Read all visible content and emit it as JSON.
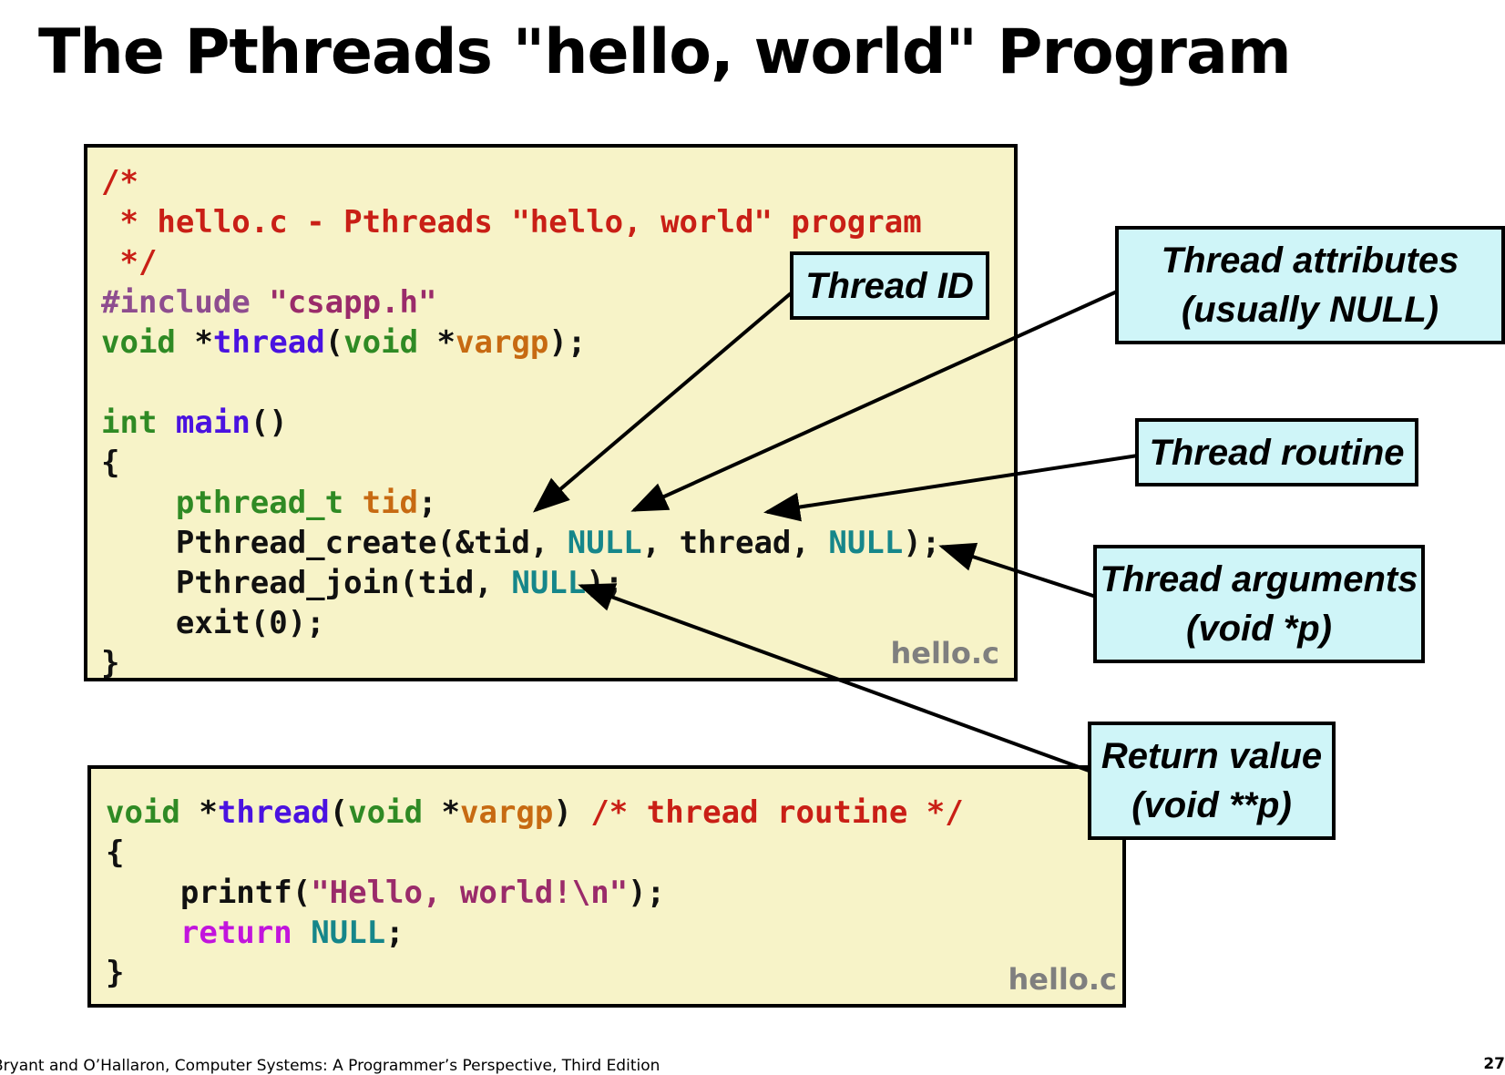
{
  "slide": {
    "title": "The Pthreads \"hello, world\" Program",
    "page_number": "27",
    "footer": "Bryant and O’Hallaron, Computer Systems: A Programmer’s Perspective, Third Edition"
  },
  "main_code": {
    "filename": "hello.c",
    "lines": [
      [
        {
          "t": "/*",
          "c": "comment"
        }
      ],
      [
        {
          "t": " * hello.c - Pthreads \"hello, world\" program",
          "c": "comment"
        }
      ],
      [
        {
          "t": " */",
          "c": "comment"
        }
      ],
      [
        {
          "t": "#include ",
          "c": "pre"
        },
        {
          "t": "\"csapp.h\"",
          "c": "str"
        }
      ],
      [
        {
          "t": "void",
          "c": "type"
        },
        {
          "t": " *",
          "c": ""
        },
        {
          "t": "thread",
          "c": "fn"
        },
        {
          "t": "(",
          "c": ""
        },
        {
          "t": "void",
          "c": "type"
        },
        {
          "t": " *",
          "c": ""
        },
        {
          "t": "vargp",
          "c": "var"
        },
        {
          "t": ");",
          "c": ""
        }
      ],
      [],
      [
        {
          "t": "int",
          "c": "type"
        },
        {
          "t": " ",
          "c": ""
        },
        {
          "t": "main",
          "c": "fn"
        },
        {
          "t": "()",
          "c": ""
        }
      ],
      [
        {
          "t": "{",
          "c": ""
        }
      ],
      [
        {
          "t": "    ",
          "c": ""
        },
        {
          "t": "pthread_t",
          "c": "type"
        },
        {
          "t": " ",
          "c": ""
        },
        {
          "t": "tid",
          "c": "var"
        },
        {
          "t": ";",
          "c": ""
        }
      ],
      [
        {
          "t": "    Pthread_create(&tid, ",
          "c": ""
        },
        {
          "t": "NULL",
          "c": "null"
        },
        {
          "t": ", thread, ",
          "c": ""
        },
        {
          "t": "NULL",
          "c": "null"
        },
        {
          "t": ");",
          "c": ""
        }
      ],
      [
        {
          "t": "    Pthread_join(tid, ",
          "c": ""
        },
        {
          "t": "NULL",
          "c": "null"
        },
        {
          "t": ");",
          "c": ""
        }
      ],
      [
        {
          "t": "    exit(0);",
          "c": ""
        }
      ],
      [
        {
          "t": "}",
          "c": ""
        }
      ]
    ]
  },
  "thread_code": {
    "filename": "hello.c",
    "lines": [
      [
        {
          "t": "void",
          "c": "type"
        },
        {
          "t": " *",
          "c": ""
        },
        {
          "t": "thread",
          "c": "fn"
        },
        {
          "t": "(",
          "c": ""
        },
        {
          "t": "void",
          "c": "type"
        },
        {
          "t": " *",
          "c": ""
        },
        {
          "t": "vargp",
          "c": "var"
        },
        {
          "t": ") ",
          "c": ""
        },
        {
          "t": "/* thread routine */",
          "c": "comment"
        }
      ],
      [
        {
          "t": "{",
          "c": ""
        }
      ],
      [
        {
          "t": "    printf(",
          "c": ""
        },
        {
          "t": "\"Hello, world!\\n\"",
          "c": "str"
        },
        {
          "t": ");",
          "c": ""
        }
      ],
      [
        {
          "t": "    ",
          "c": ""
        },
        {
          "t": "return",
          "c": "kw"
        },
        {
          "t": " ",
          "c": ""
        },
        {
          "t": "NULL",
          "c": "null"
        },
        {
          "t": ";",
          "c": ""
        }
      ],
      [
        {
          "t": "}",
          "c": ""
        }
      ]
    ]
  },
  "callouts": {
    "thread_id": {
      "line1": "Thread ID"
    },
    "thread_attributes": {
      "line1": "Thread attributes",
      "line2": "(usually NULL)"
    },
    "thread_routine": {
      "line1": "Thread routine"
    },
    "thread_arguments": {
      "line1": "Thread arguments",
      "line2": "(void *p)"
    },
    "return_value": {
      "line1": "Return value",
      "line2": "(void **p)"
    }
  },
  "colors": {
    "code_background": "#f7f3c8",
    "callout_background": "#cff5f8",
    "comment": "#c91f16",
    "type": "#2f8a24",
    "function": "#4a12e0",
    "variable": "#c76a12",
    "null": "#16868a",
    "keyword": "#c214dd"
  }
}
